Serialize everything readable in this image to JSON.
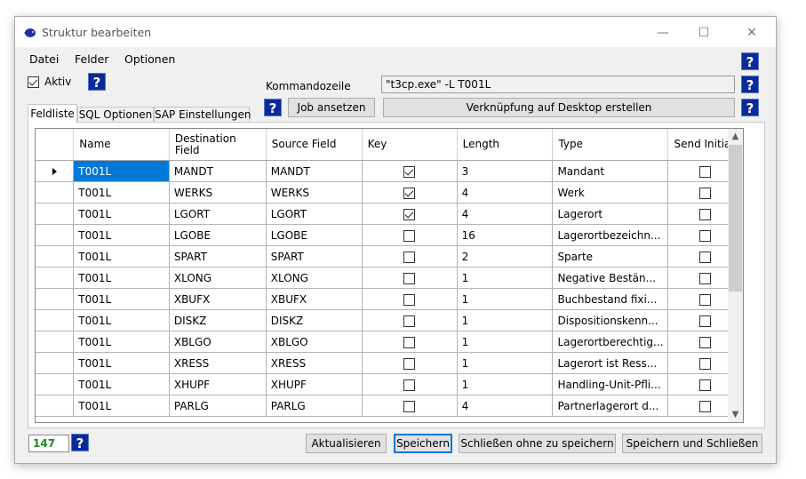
{
  "window": {
    "title": "Struktur bearbeiten",
    "controls": {
      "minimize": "—",
      "maximize": "☐",
      "close": "✕"
    }
  },
  "menu": {
    "items": [
      "Datei",
      "Felder",
      "Optionen"
    ]
  },
  "options": {
    "aktiv_label": "Aktiv",
    "aktiv_checked": true
  },
  "command": {
    "label": "Kommandozeile",
    "value": "\"t3cp.exe\" -L T001L",
    "job_button": "Job ansetzen",
    "shortcut_button": "Verknüpfung auf Desktop erstellen"
  },
  "help_glyph": "?",
  "tabs": [
    {
      "label": "Feldliste",
      "active": true
    },
    {
      "label": "SQL Optionen",
      "active": false
    },
    {
      "label": "SAP Einstellungen",
      "active": false
    }
  ],
  "table": {
    "columns": [
      "Name",
      "Destination Field",
      "Source Field",
      "Key",
      "Length",
      "Type",
      "Send Initial"
    ],
    "rows": [
      {
        "name": "T001L",
        "dest": "MANDT",
        "src": "MANDT",
        "key": true,
        "length": "3",
        "type": "Mandant",
        "send_initial": false
      },
      {
        "name": "T001L",
        "dest": "WERKS",
        "src": "WERKS",
        "key": true,
        "length": "4",
        "type": "Werk",
        "send_initial": false
      },
      {
        "name": "T001L",
        "dest": "LGORT",
        "src": "LGORT",
        "key": true,
        "length": "4",
        "type": "Lagerort",
        "send_initial": false
      },
      {
        "name": "T001L",
        "dest": "LGOBE",
        "src": "LGOBE",
        "key": false,
        "length": "16",
        "type": "Lagerortbezeichn...",
        "send_initial": false
      },
      {
        "name": "T001L",
        "dest": "SPART",
        "src": "SPART",
        "key": false,
        "length": "2",
        "type": "Sparte",
        "send_initial": false
      },
      {
        "name": "T001L",
        "dest": "XLONG",
        "src": "XLONG",
        "key": false,
        "length": "1",
        "type": "Negative Bestän...",
        "send_initial": false
      },
      {
        "name": "T001L",
        "dest": "XBUFX",
        "src": "XBUFX",
        "key": false,
        "length": "1",
        "type": "Buchbestand fixi...",
        "send_initial": false
      },
      {
        "name": "T001L",
        "dest": "DISKZ",
        "src": "DISKZ",
        "key": false,
        "length": "1",
        "type": "Dispositionskenn...",
        "send_initial": false
      },
      {
        "name": "T001L",
        "dest": "XBLGO",
        "src": "XBLGO",
        "key": false,
        "length": "1",
        "type": "Lagerortberechtig...",
        "send_initial": false
      },
      {
        "name": "T001L",
        "dest": "XRESS",
        "src": "XRESS",
        "key": false,
        "length": "1",
        "type": "Lagerort ist Ress...",
        "send_initial": false
      },
      {
        "name": "T001L",
        "dest": "XHUPF",
        "src": "XHUPF",
        "key": false,
        "length": "1",
        "type": "Handling-Unit-Pfli...",
        "send_initial": false
      },
      {
        "name": "T001L",
        "dest": "PARLG",
        "src": "PARLG",
        "key": false,
        "length": "4",
        "type": "Partnerlagerort d...",
        "send_initial": false
      }
    ]
  },
  "footer": {
    "count": "147",
    "buttons": {
      "refresh": "Aktualisieren",
      "save": "Speichern",
      "close_no_save": "Schließen ohne zu speichern",
      "save_close": "Speichern und Schließen"
    }
  }
}
